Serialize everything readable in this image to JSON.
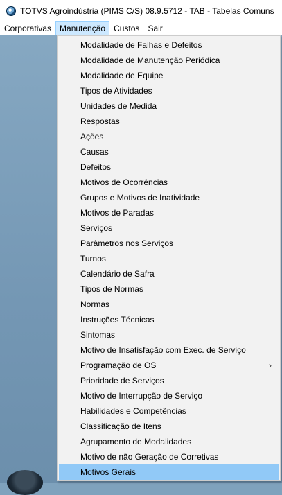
{
  "window": {
    "title": "TOTVS Agroindústria (PIMS C/S) 08.9.5712 - TAB - Tabelas Comuns",
    "app_icon": "totvs-logo-icon"
  },
  "menubar": {
    "items": [
      {
        "label": "Corporativas"
      },
      {
        "label": "Manutenção",
        "active": true
      },
      {
        "label": "Custos"
      },
      {
        "label": "Sair"
      }
    ]
  },
  "dropdown": {
    "items": [
      {
        "label": "Modalidade de Falhas e Defeitos"
      },
      {
        "label": "Modalidade de Manutenção Periódica"
      },
      {
        "label": "Modalidade de Equipe"
      },
      {
        "label": "Tipos de Atividades"
      },
      {
        "label": "Unidades de Medida"
      },
      {
        "label": "Respostas"
      },
      {
        "label": "Ações"
      },
      {
        "label": "Causas"
      },
      {
        "label": "Defeitos"
      },
      {
        "label": "Motivos de Ocorrências"
      },
      {
        "label": "Grupos e Motivos de Inatividade"
      },
      {
        "label": "Motivos de Paradas"
      },
      {
        "label": "Serviços"
      },
      {
        "label": "Parâmetros nos Serviços"
      },
      {
        "label": "Turnos"
      },
      {
        "label": "Calendário de Safra"
      },
      {
        "label": "Tipos de Normas"
      },
      {
        "label": "Normas"
      },
      {
        "label": "Instruções Técnicas"
      },
      {
        "label": "Sintomas"
      },
      {
        "label": "Motivo de Insatisfação com Exec. de Serviço"
      },
      {
        "label": "Programação de OS",
        "submenu_arrow": "›"
      },
      {
        "label": "Prioridade de Serviços"
      },
      {
        "label": "Motivo de Interrupção de Serviço"
      },
      {
        "label": "Habilidades e Competências"
      },
      {
        "label": "Classificação de Itens"
      },
      {
        "label": "Agrupamento de Modalidades"
      },
      {
        "label": "Motivo de não Geração de Corretivas"
      },
      {
        "label": "Motivos Gerais",
        "highlighted": true
      }
    ]
  },
  "colors": {
    "menubar_active_bg": "#cce8ff",
    "menu_highlight_bg": "#91c9f7",
    "dropdown_bg": "#f2f2f2",
    "workspace_bg": "#7fa2bd"
  }
}
